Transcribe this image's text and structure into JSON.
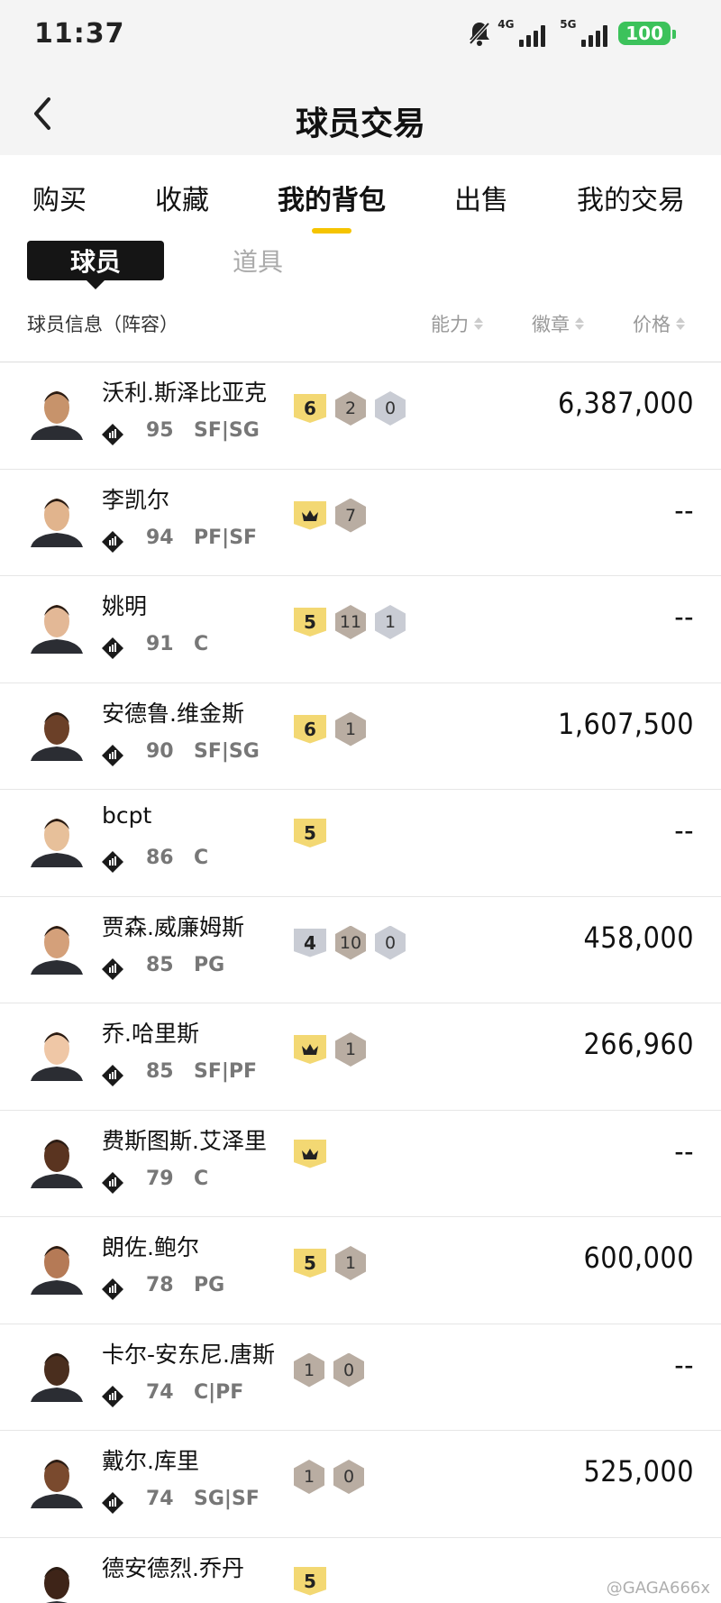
{
  "status": {
    "time": "11:37",
    "net1": "4G",
    "net2": "5G",
    "battery": "100"
  },
  "header": {
    "title": "球员交易"
  },
  "tabs": [
    {
      "label": "购买"
    },
    {
      "label": "收藏"
    },
    {
      "label": "我的背包"
    },
    {
      "label": "出售"
    },
    {
      "label": "我的交易"
    }
  ],
  "segment": {
    "players": "球员",
    "items": "道具"
  },
  "columns": {
    "info": "球员信息（阵容）",
    "ability": "能力",
    "badge": "徽章",
    "price": "价格"
  },
  "players": [
    {
      "name": "沃利.斯泽比亚克",
      "rating": "95",
      "pos": "SF|SG",
      "price": "6,387,000",
      "badges": [
        {
          "k": "gold",
          "v": "6"
        },
        {
          "k": "hex-bronze",
          "v": "2"
        },
        {
          "k": "hex-silver",
          "v": "0"
        }
      ]
    },
    {
      "name": "李凯尔",
      "rating": "94",
      "pos": "PF|SF",
      "price": "--",
      "badges": [
        {
          "k": "crown"
        },
        {
          "k": "hex-bronze",
          "v": "7"
        }
      ]
    },
    {
      "name": "姚明",
      "rating": "91",
      "pos": "C",
      "price": "--",
      "badges": [
        {
          "k": "gold",
          "v": "5"
        },
        {
          "k": "hex-bronze",
          "v": "11"
        },
        {
          "k": "hex-silver",
          "v": "1"
        }
      ]
    },
    {
      "name": "安德鲁.维金斯",
      "rating": "90",
      "pos": "SF|SG",
      "price": "1,607,500",
      "badges": [
        {
          "k": "gold",
          "v": "6"
        },
        {
          "k": "hex-bronze",
          "v": "1"
        }
      ]
    },
    {
      "name": "bcpt",
      "rating": "86",
      "pos": "C",
      "price": "--",
      "badges": [
        {
          "k": "gold",
          "v": "5"
        }
      ]
    },
    {
      "name": "贾森.威廉姆斯",
      "rating": "85",
      "pos": "PG",
      "price": "458,000",
      "badges": [
        {
          "k": "silver",
          "v": "4"
        },
        {
          "k": "hex-bronze",
          "v": "10"
        },
        {
          "k": "hex-silver",
          "v": "0"
        }
      ]
    },
    {
      "name": "乔.哈里斯",
      "rating": "85",
      "pos": "SF|PF",
      "price": "266,960",
      "badges": [
        {
          "k": "crown"
        },
        {
          "k": "hex-bronze",
          "v": "1"
        }
      ]
    },
    {
      "name": "费斯图斯.艾泽里",
      "rating": "79",
      "pos": "C",
      "price": "--",
      "badges": [
        {
          "k": "crown"
        }
      ]
    },
    {
      "name": "朗佐.鲍尔",
      "rating": "78",
      "pos": "PG",
      "price": "600,000",
      "badges": [
        {
          "k": "gold",
          "v": "5"
        },
        {
          "k": "hex-bronze",
          "v": "1"
        }
      ]
    },
    {
      "name": "卡尔-安东尼.唐斯",
      "rating": "74",
      "pos": "C|PF",
      "price": "--",
      "badges": [
        {
          "k": "hex-bronze",
          "v": "1"
        },
        {
          "k": "hex-bronze",
          "v": "0"
        }
      ]
    },
    {
      "name": "戴尔.库里",
      "rating": "74",
      "pos": "SG|SF",
      "price": "525,000",
      "badges": [
        {
          "k": "hex-bronze",
          "v": "1"
        },
        {
          "k": "hex-bronze",
          "v": "0"
        }
      ]
    },
    {
      "name": "德安德烈.乔丹",
      "rating": "",
      "pos": "",
      "price": "",
      "badges": [
        {
          "k": "gold",
          "v": "5"
        }
      ]
    }
  ],
  "watermark": "@GAGA666x",
  "colors": {
    "accent": "#f5c400",
    "gold_badge": "#f3d873",
    "bronze_badge": "#b9ada2",
    "silver_badge": "#c9ccd4"
  }
}
